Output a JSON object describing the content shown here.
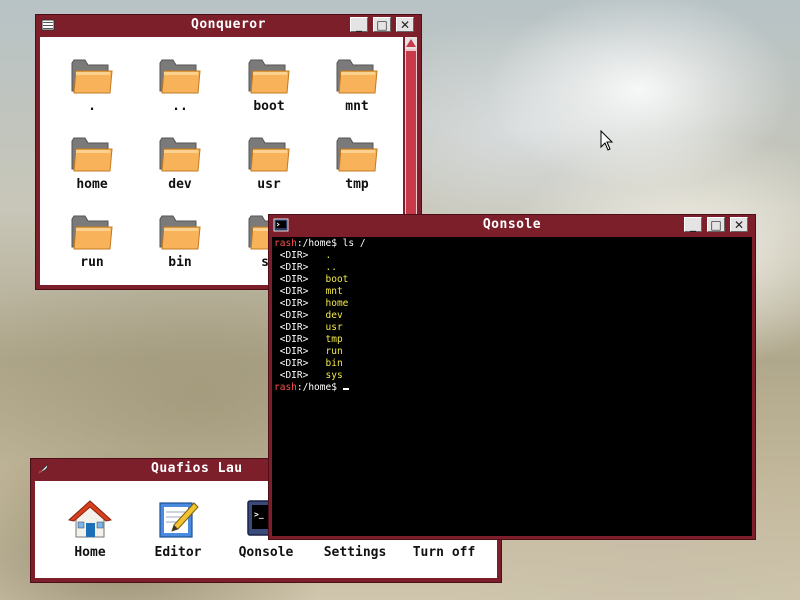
{
  "file_manager": {
    "title": "Qonqueror",
    "items": [
      {
        "label": "."
      },
      {
        "label": ".."
      },
      {
        "label": "boot"
      },
      {
        "label": "mnt"
      },
      {
        "label": "home"
      },
      {
        "label": "dev"
      },
      {
        "label": "usr"
      },
      {
        "label": "tmp"
      },
      {
        "label": "run"
      },
      {
        "label": "bin"
      },
      {
        "label": "sy"
      }
    ]
  },
  "console": {
    "title": "Qonsole",
    "prompt_user": "rash",
    "prompt_path": ":/home$",
    "command": " ls /",
    "dir_tag": "<DIR>",
    "entries": [
      ".",
      "..",
      "boot",
      "mnt",
      "home",
      "dev",
      "usr",
      "tmp",
      "run",
      "bin",
      "sys"
    ]
  },
  "launcher": {
    "title": "Quafios Lau",
    "items": [
      {
        "label": "Home",
        "icon": "home-icon"
      },
      {
        "label": "Editor",
        "icon": "editor-icon"
      },
      {
        "label": "Qonsole",
        "icon": "terminal-icon"
      },
      {
        "label": "Settings",
        "icon": "settings-icon"
      },
      {
        "label": "Turn off",
        "icon": "power-icon"
      }
    ]
  },
  "window_buttons": {
    "minimize": "_",
    "maximize": "□",
    "close": "✕"
  },
  "colors": {
    "frame": "#7d1e2b",
    "folder": "#f7b25a",
    "console_bg": "#000000",
    "prompt": "#ff4e4e",
    "entry": "#f2ea4a"
  }
}
